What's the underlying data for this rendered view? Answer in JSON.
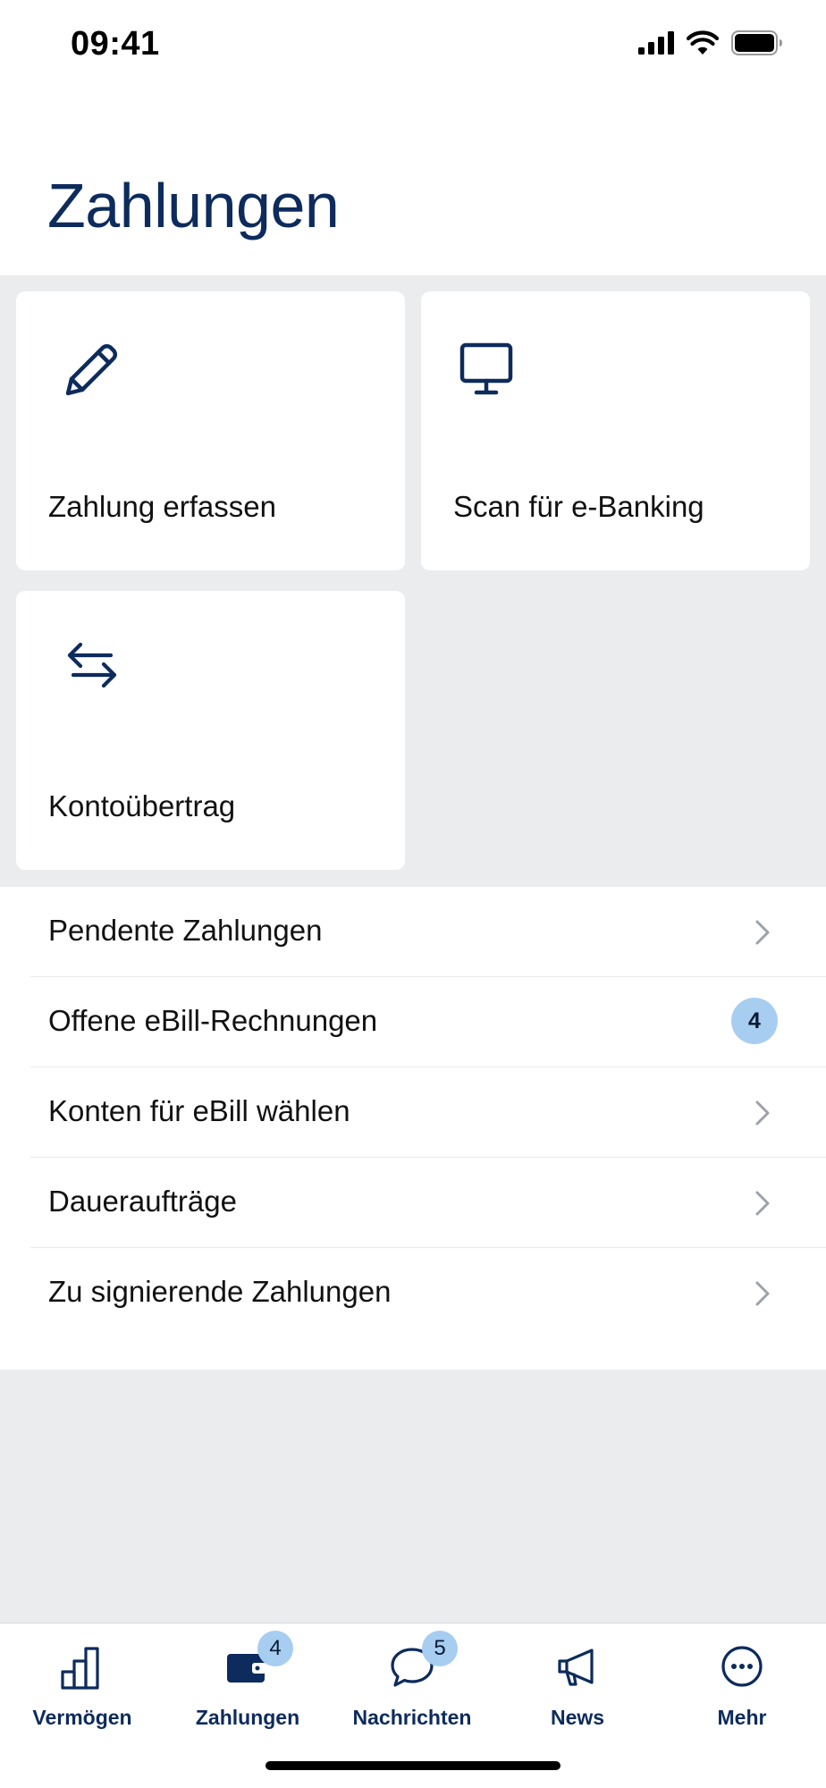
{
  "status_bar": {
    "time": "09:41"
  },
  "header": {
    "title": "Zahlungen"
  },
  "tiles": [
    {
      "label": "Zahlung erfassen",
      "icon": "pencil-icon"
    },
    {
      "label": "Scan für e-Banking",
      "icon": "monitor-icon"
    },
    {
      "label": "Kontoübertrag",
      "icon": "transfer-arrows-icon"
    }
  ],
  "list": [
    {
      "label": "Pendente Zahlungen",
      "accessory": "chevron"
    },
    {
      "label": "Offene eBill-Rechnungen",
      "badge": "4"
    },
    {
      "label": "Konten für eBill wählen",
      "accessory": "chevron"
    },
    {
      "label": "Daueraufträge",
      "accessory": "chevron"
    },
    {
      "label": "Zu signierende Zahlungen",
      "accessory": "chevron"
    }
  ],
  "tab_bar": {
    "items": [
      {
        "label": "Vermögen",
        "icon": "bar-chart-icon"
      },
      {
        "label": "Zahlungen",
        "icon": "wallet-icon",
        "badge": "4",
        "selected": true
      },
      {
        "label": "Nachrichten",
        "icon": "chat-bubble-icon",
        "badge": "5"
      },
      {
        "label": "News",
        "icon": "megaphone-icon"
      },
      {
        "label": "Mehr",
        "icon": "more-icon"
      }
    ]
  },
  "colors": {
    "brand_navy": "#0d2b5c",
    "badge_blue": "#a7cdf1",
    "background_grey": "#ebecee"
  }
}
